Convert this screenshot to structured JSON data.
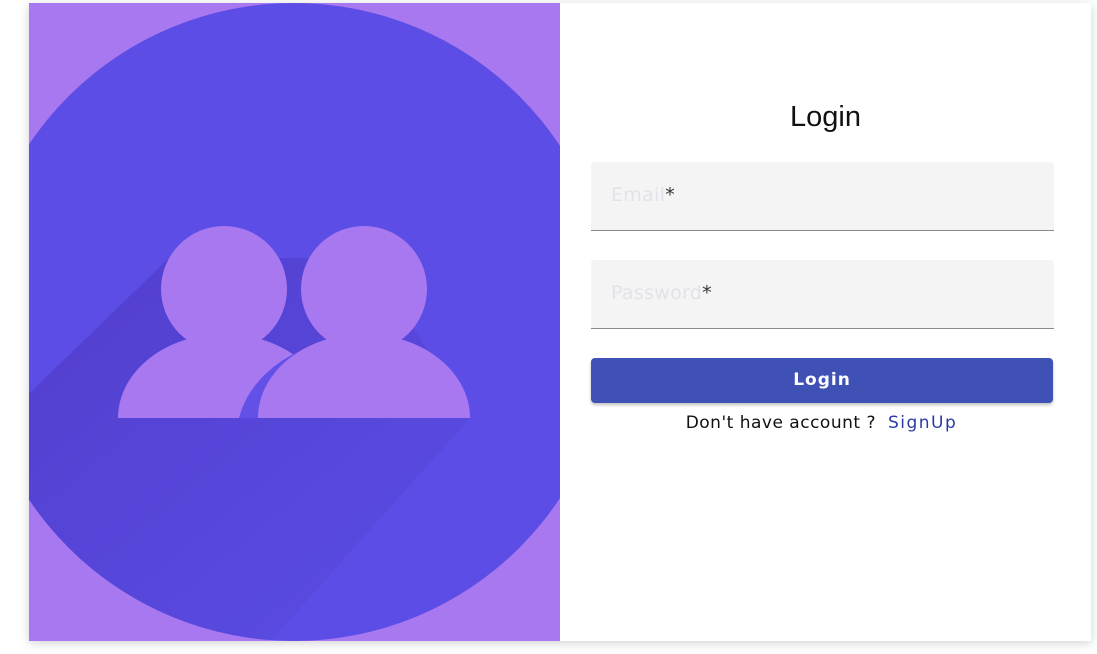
{
  "illustration": {
    "icon": "users-group-icon",
    "background_color": "#a878f0",
    "circle_color": "#5b4de5",
    "figure_color": "#a878f0"
  },
  "login_form": {
    "title": "Login",
    "email_label": "Email",
    "password_label": "Password",
    "required_marker": "*",
    "submit_label": "Login",
    "signup_prompt": "Don't have account ?",
    "signup_link": "SignUp"
  },
  "colors": {
    "primary_button": "#3f51b5",
    "link": "#2b3aa7",
    "field_background": "#f4f4f4"
  }
}
